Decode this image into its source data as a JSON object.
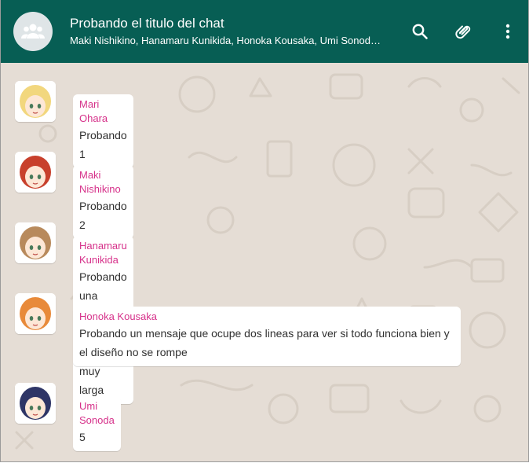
{
  "header": {
    "title": "Probando el titulo del chat",
    "participants": "Maki Nishikino, Hanamaru Kunikida, Honoka Kousaka, Umi Sonod…",
    "avatar_icon": "group-icon",
    "actions": [
      {
        "name": "search-icon"
      },
      {
        "name": "paperclip-icon"
      },
      {
        "name": "more-vert-icon"
      }
    ],
    "color": "#075e54"
  },
  "messages": [
    {
      "sender": "Mari Ohara",
      "text": "Probando 1",
      "hair": "#f2d77e"
    },
    {
      "sender": "Maki Nishikino",
      "text": "Probando 2",
      "hair": "#c8402c"
    },
    {
      "sender": "Hanamaru Kunikida",
      "text": "Probando una cadena de texto que sea muy larga",
      "hair": "#b88a5c"
    },
    {
      "sender": "Honoka Kousaka",
      "text": "Probando un mensaje que ocupe dos lineas para ver si todo funciona bien y el diseño no se rompe",
      "hair": "#e88a3a"
    },
    {
      "sender": "Umi Sonoda",
      "text": "5",
      "hair": "#2e3566"
    }
  ],
  "colors": {
    "sender": "#d6318a",
    "chat_bg": "#e5ddd5"
  }
}
